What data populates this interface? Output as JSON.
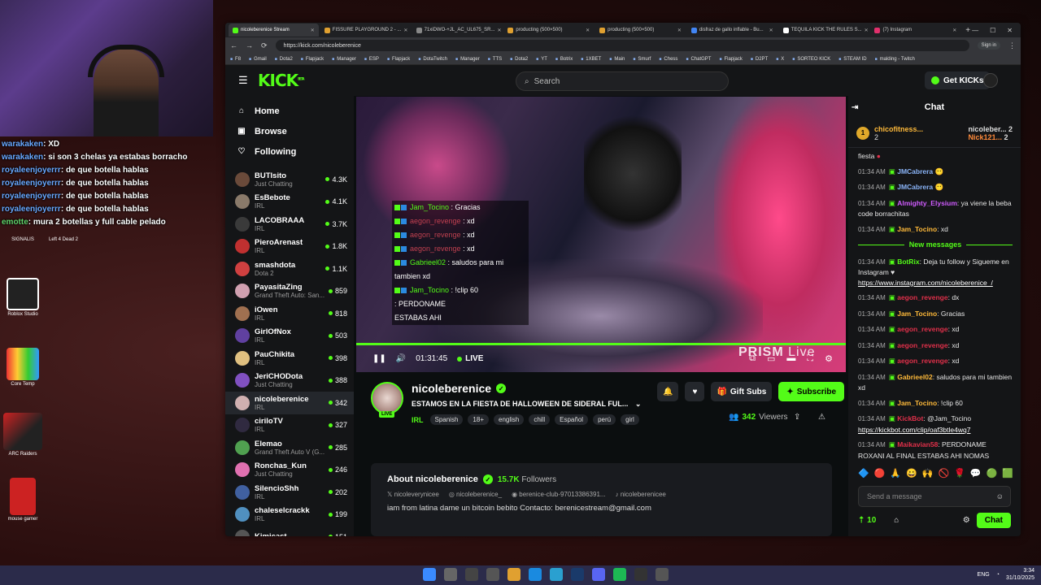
{
  "overlay_chat": [
    {
      "user": "warakaken",
      "text": "XD"
    },
    {
      "user": "warakaken",
      "text": "si son 3 chelas ya estabas borracho"
    },
    {
      "user": "royaleenjoyerrr",
      "text": "de que botella hablas"
    },
    {
      "user": "royaleenjoyerrr",
      "text": "de que botella hablas"
    },
    {
      "user": "royaleenjoyerrr",
      "text": "de que botella hablas"
    },
    {
      "user": "royaleenjoyerrr",
      "text": "de que botella hablas"
    },
    {
      "user": "emotte",
      "text": "mura 2 botellas y full cable pelado"
    }
  ],
  "desktop": {
    "icons": [
      {
        "label": "SIGNALIS"
      },
      {
        "label": "Left 4 Dead 2"
      },
      {
        "label": "Roblox Studio"
      },
      {
        "label": "Core Temp"
      },
      {
        "label": "ARC Raiders"
      },
      {
        "label": "mouse gamer"
      }
    ]
  },
  "browser": {
    "tabs": [
      {
        "label": "nicoleberenice Stream",
        "active": true
      },
      {
        "label": "FISSURE PLAYGROUND 2 - ..."
      },
      {
        "label": "71xiDWO-+JL_AC_UL675_SR..."
      },
      {
        "label": "producting (500×500)"
      },
      {
        "label": "producting (500×500)"
      },
      {
        "label": "disfraz de gallo inflable - Bu..."
      },
      {
        "label": "TEQUILA KICK THE RULES S..."
      },
      {
        "label": "(7) Instagram"
      }
    ],
    "url": "https://kick.com/nicoleberenice",
    "sign_in": "Sign in",
    "bookmarks": [
      "F8",
      "Gmail",
      "Dota2",
      "Flapjack",
      "Manager",
      "ESP",
      "Flapjack",
      "DotaTwitch",
      "Manager",
      "TTS",
      "Dota2",
      "YT",
      "Botrix",
      "1XBET",
      "Main",
      "Smurf",
      "Chess",
      "ChatGPT",
      "Flapjack",
      "D2PT",
      "X",
      "SORTEO KICK",
      "STEAM ID",
      "malding - Twitch"
    ]
  },
  "header": {
    "logo": "KICK",
    "logo_sup": "BETA",
    "search_placeholder": "Search",
    "get_kicks": "Get KICKs"
  },
  "sidebar": {
    "nav": [
      {
        "label": "Home",
        "icon": "home-icon"
      },
      {
        "label": "Browse",
        "icon": "browse-icon"
      },
      {
        "label": "Following",
        "icon": "heart-icon"
      }
    ],
    "channels": [
      {
        "name": "BUTIsito",
        "category": "Just Chatting",
        "viewers": "4.3K",
        "color": "#6a4a3a"
      },
      {
        "name": "EsBebote",
        "category": "IRL",
        "viewers": "4.1K",
        "color": "#8a7a6a"
      },
      {
        "name": "LACOBRAAA",
        "category": "IRL",
        "viewers": "3.7K",
        "color": "#3a3a3a"
      },
      {
        "name": "PieroArenast",
        "category": "IRL",
        "viewers": "1.8K",
        "color": "#c03030"
      },
      {
        "name": "smashdota",
        "category": "Dota 2",
        "viewers": "1.1K",
        "color": "#d04040"
      },
      {
        "name": "PayasitaZing",
        "category": "Grand Theft Auto: San...",
        "viewers": "859",
        "color": "#d0a0b0"
      },
      {
        "name": "iOwen",
        "category": "IRL",
        "viewers": "818",
        "color": "#a07050"
      },
      {
        "name": "GirlOfNox",
        "category": "IRL",
        "viewers": "503",
        "color": "#6040a0"
      },
      {
        "name": "PauChikita",
        "category": "IRL",
        "viewers": "398",
        "color": "#e0c080"
      },
      {
        "name": "JeriCHODota",
        "category": "Just Chatting",
        "viewers": "388",
        "color": "#8050c0"
      },
      {
        "name": "nicoleberenice",
        "category": "IRL",
        "viewers": "342",
        "color": "#d0b0b0",
        "active": true
      },
      {
        "name": "ciriloTV",
        "category": "IRL",
        "viewers": "327",
        "color": "#302a40"
      },
      {
        "name": "Elemao",
        "category": "Grand Theft Auto V (G...",
        "viewers": "285",
        "color": "#50a050"
      },
      {
        "name": "Ronchas_Kun",
        "category": "Just Chatting",
        "viewers": "246",
        "color": "#e070b0"
      },
      {
        "name": "SilencioShh",
        "category": "IRL",
        "viewers": "202",
        "color": "#4060a0"
      },
      {
        "name": "chaleselcrackk",
        "category": "IRL",
        "viewers": "199",
        "color": "#5090c0"
      },
      {
        "name": "Kimicast",
        "category": "",
        "viewers": "151",
        "color": "#555"
      }
    ]
  },
  "video": {
    "overlay_chat": [
      {
        "user": "Jam_Tocino",
        "text": "Gracias",
        "color": "#53fc18"
      },
      {
        "user": "aegon_revenge",
        "text": "xd",
        "color": "#c04050"
      },
      {
        "user": "aegon_revenge",
        "text": "xd",
        "color": "#c04050"
      },
      {
        "user": "aegon_revenge",
        "text": "xd",
        "color": "#c04050"
      },
      {
        "user": "Gabrieel02",
        "text": "saludos para mi tambien xd",
        "color": "#53fc18"
      },
      {
        "user": "Jam_Tocino",
        "text": "!clip 60",
        "color": "#53fc18"
      },
      {
        "user": "",
        "text": ": PERDONAME",
        "color": "#fff"
      },
      {
        "user": "",
        "text": "ESTABAS AHI",
        "color": "#fff"
      }
    ],
    "watermark": "PRISM",
    "watermark_live": "Live",
    "time": "01:31:45",
    "live": "LIVE"
  },
  "stream": {
    "name": "nicoleberenice",
    "title": "ESTAMOS EN LA FIESTA DE HALLOWEEN DE SIDERAL FUL...",
    "category": "IRL",
    "tags": [
      "Spanish",
      "18+",
      "english",
      "chill",
      "Español",
      "perú",
      "girl"
    ],
    "live_badge": "LIVE",
    "gift_subs": "Gift Subs",
    "subscribe": "Subscribe",
    "viewers": "342",
    "viewers_label": "Viewers"
  },
  "about": {
    "title": "About nicoleberenice",
    "followers": "15.7K",
    "followers_label": "Followers",
    "socials": [
      "nicoleverynicee",
      "nicoleberenice_",
      "berenice-club-97013386391...",
      "nicoleberenicee"
    ],
    "bio": "iam from latina dame un bitcoin bebito Contacto: berenicestream@gmail.com"
  },
  "chat": {
    "title": "Chat",
    "leaders": [
      {
        "name": "chicofitness...",
        "count": "2"
      },
      {
        "name": "nicoleber...",
        "count": "2"
      },
      {
        "name": "Nick121...",
        "count": "2"
      }
    ],
    "rank": "1",
    "top_fragment": "fiesta",
    "messages_before": [
      {
        "time": "01:34 AM",
        "user": "JMCabrera",
        "text": "",
        "color": "#8ab4f8"
      },
      {
        "time": "01:34 AM",
        "user": "JMCabrera",
        "text": "",
        "color": "#8ab4f8"
      },
      {
        "time": "01:34 AM",
        "user": "Almighty_Elysium",
        "text": "ya viene la beba code borrachitas",
        "color": "#d05cff"
      },
      {
        "time": "01:34 AM",
        "user": "Jam_Tocino",
        "text": "xd",
        "color": "#ffba3a"
      }
    ],
    "new_messages": "New messages",
    "messages_after": [
      {
        "time": "01:34 AM",
        "user": "BotRix",
        "text": "Deja tu follow y Sigueme en Instagram ♥",
        "link": "https://www.instagram.com/nicoleberenice_/",
        "color": "#53fc18"
      },
      {
        "time": "01:34 AM",
        "user": "aegon_revenge",
        "text": "dx",
        "color": "#e0304a"
      },
      {
        "time": "01:34 AM",
        "user": "Jam_Tocino",
        "text": "Gracias",
        "color": "#ffba3a"
      },
      {
        "time": "01:34 AM",
        "user": "aegon_revenge",
        "text": "xd",
        "color": "#e0304a"
      },
      {
        "time": "01:34 AM",
        "user": "aegon_revenge",
        "text": "xd",
        "color": "#e0304a"
      },
      {
        "time": "01:34 AM",
        "user": "aegon_revenge",
        "text": "xd",
        "color": "#e0304a"
      },
      {
        "time": "01:34 AM",
        "user": "Gabrieel02",
        "text": "saludos para mi tambien xd",
        "color": "#ffba3a"
      },
      {
        "time": "01:34 AM",
        "user": "Jam_Tocino",
        "text": "!clip 60",
        "color": "#ffba3a"
      },
      {
        "time": "01:34 AM",
        "user": "KickBot",
        "text": "@Jam_Tocino",
        "link": "https://kickbot.com/clip/oaf3btle4wq7",
        "color": "#e0304a"
      },
      {
        "time": "01:34 AM",
        "user": "Maikavian58",
        "text": "PERDONAME ROXANI AL FINAL ESTABAS AHI NOMAS",
        "color": "#e0304a"
      }
    ],
    "input_placeholder": "Send a message",
    "points": "10",
    "send": "Chat"
  },
  "taskbar": {
    "lang": "ENG",
    "time": "3:34",
    "date": "31/10/2025"
  }
}
